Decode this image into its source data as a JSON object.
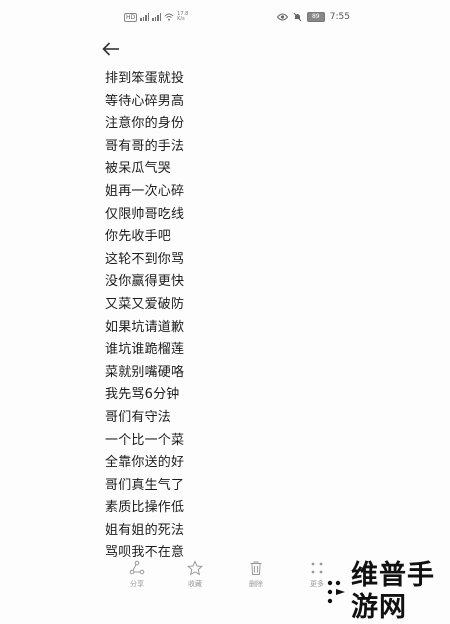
{
  "status_bar": {
    "left_text": "HD",
    "net_speed_top": "17.8",
    "net_speed_bottom": "K/s",
    "battery": "89",
    "time": "7:55"
  },
  "note": {
    "lines": [
      "排到笨蛋就投",
      "等待心碎男高",
      "注意你的身份",
      "哥有哥的手法",
      "被呆瓜气哭",
      "姐再一次心碎",
      "仅限帅哥吃线",
      "你先收手吧",
      "这轮不到你骂",
      "没你赢得更快",
      "又菜又爱破防",
      "如果坑请道歉",
      "谁坑谁跪榴莲",
      "菜就别嘴硬咯",
      "我先骂6分钟",
      "哥们有守法",
      "一个比一个菜",
      "全靠你送的好",
      "哥们真生气了",
      "素质比操作低",
      "姐有姐的死法",
      "骂呗我不在意"
    ]
  },
  "toolbar": {
    "share_label": "分享",
    "favorite_label": "收藏",
    "delete_label": "删除",
    "more_label": "更多"
  },
  "watermark": {
    "text": "维普手游网"
  },
  "colors": {
    "background": "#fdfdfd",
    "text": "#1c1c1c",
    "toolbar_icon": "#9a9a9a"
  }
}
